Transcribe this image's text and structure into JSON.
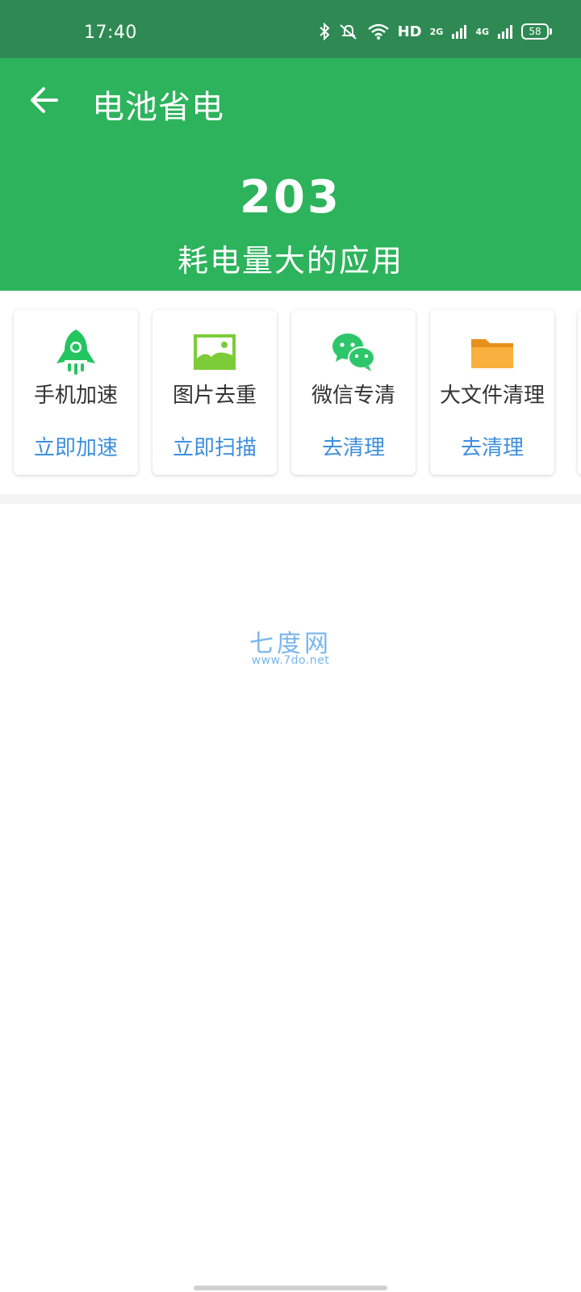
{
  "status_bar": {
    "time": "17:40",
    "network_hd": "HD",
    "network_2g": "2G",
    "network_4g": "4G",
    "battery": "58",
    "icons": [
      "bluetooth-icon",
      "mute-icon",
      "wifi-icon",
      "signal-icon",
      "battery-icon"
    ]
  },
  "header": {
    "title": "电池省电",
    "count": "203",
    "count_label": "耗电量大的应用",
    "color": "#2db35c"
  },
  "tools": [
    {
      "name": "手机加速",
      "action": "立即加速",
      "icon": "rocket-icon"
    },
    {
      "name": "图片去重",
      "action": "立即扫描",
      "icon": "image-icon"
    },
    {
      "name": "微信专清",
      "action": "去清理",
      "icon": "wechat-icon"
    },
    {
      "name": "大文件清理",
      "action": "去清理",
      "icon": "folder-icon"
    }
  ],
  "watermark": {
    "title": "七度网",
    "url": "www.7do.net"
  },
  "colors": {
    "status_bar": "#2e8a52",
    "accent_blue": "#3d8fdb",
    "wechat_green": "#2dc66b",
    "folder_orange": "#f7a935"
  }
}
